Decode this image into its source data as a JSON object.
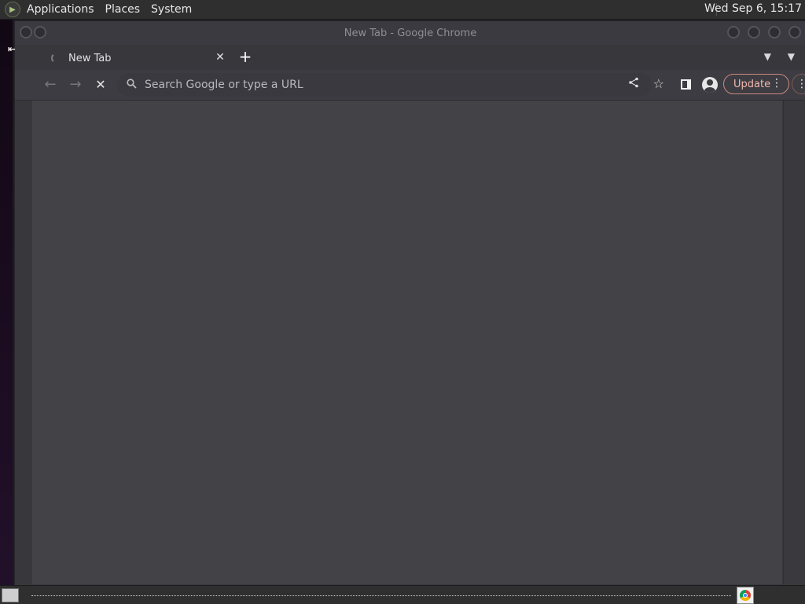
{
  "top_panel": {
    "menus": [
      "Applications",
      "Places",
      "System"
    ],
    "clock": "Wed Sep  6, 15:17"
  },
  "window": {
    "title": "New Tab - Google Chrome"
  },
  "tabs": [
    {
      "label": "New Tab"
    }
  ],
  "toolbar": {
    "omnibox_placeholder": "Search Google or type a URL",
    "omnibox_value": "",
    "update_label": "Update"
  },
  "icons": {
    "back": "arrow-left-icon",
    "forward": "arrow-right-icon",
    "stop": "close-icon",
    "search": "search-icon",
    "share": "share-icon",
    "bookmark": "star-icon",
    "side_panel": "side-panel-icon",
    "profile": "avatar-icon",
    "menu": "kebab-menu-icon"
  },
  "colors": {
    "content_bg": "#434247",
    "update_accent": "#f2b8ad"
  }
}
